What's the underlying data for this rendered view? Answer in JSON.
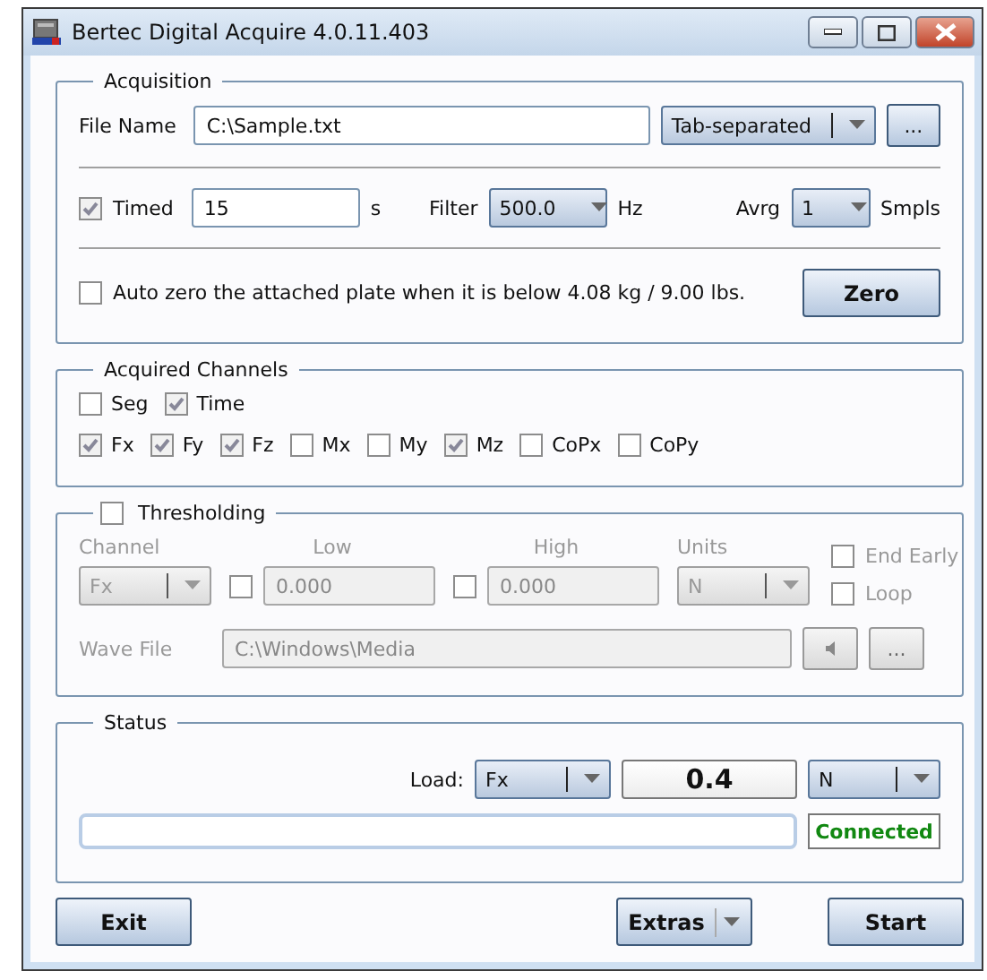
{
  "window": {
    "title": "Bertec Digital Acquire 4.0.11.403"
  },
  "acquisition": {
    "title": "Acquisition",
    "file_label": "File Name",
    "file_value": "C:\\Sample.txt",
    "format": "Tab-separated",
    "browse": "...",
    "timed": {
      "label": "Timed",
      "checked": true
    },
    "duration": "15",
    "duration_unit": "s",
    "filter_label": "Filter",
    "filter": "500.0",
    "filter_unit": "Hz",
    "avrg_label": "Avrg",
    "avrg": "1",
    "avrg_unit": "Smpls",
    "auto_zero": {
      "label": "Auto zero the attached plate when it is below 4.08 kg / 9.00 lbs.",
      "checked": false
    },
    "zero_button": "Zero"
  },
  "channels": {
    "title": "Acquired Channels",
    "rows": [
      [
        {
          "label": "Seg",
          "checked": false
        },
        {
          "label": "Time",
          "checked": true
        }
      ],
      [
        {
          "label": "Fx",
          "checked": true
        },
        {
          "label": "Fy",
          "checked": true
        },
        {
          "label": "Fz",
          "checked": true
        },
        {
          "label": "Mx",
          "checked": false
        },
        {
          "label": "My",
          "checked": false
        },
        {
          "label": "Mz",
          "checked": true
        },
        {
          "label": "CoPx",
          "checked": false
        },
        {
          "label": "CoPy",
          "checked": false
        }
      ]
    ]
  },
  "thresholding": {
    "title": "Thresholding",
    "checked": false,
    "channel_label": "Channel",
    "low_label": "Low",
    "high_label": "High",
    "units_label": "Units",
    "channel": "Fx",
    "low_checked": false,
    "low": "0.000",
    "high_checked": false,
    "high": "0.000",
    "units": "N",
    "end_early": {
      "label": "End Early",
      "checked": false
    },
    "loop": {
      "label": "Loop",
      "checked": false
    },
    "wave_label": "Wave File",
    "wave_file": "C:\\Windows\\Media",
    "browse": "..."
  },
  "status": {
    "title": "Status",
    "load_label": "Load:",
    "load_channel": "Fx",
    "load_value": "0.4",
    "load_unit": "N",
    "progress": {
      "level": 0
    },
    "connection": "Connected"
  },
  "buttons": {
    "exit": "Exit",
    "extras": "Extras",
    "start": "Start"
  }
}
